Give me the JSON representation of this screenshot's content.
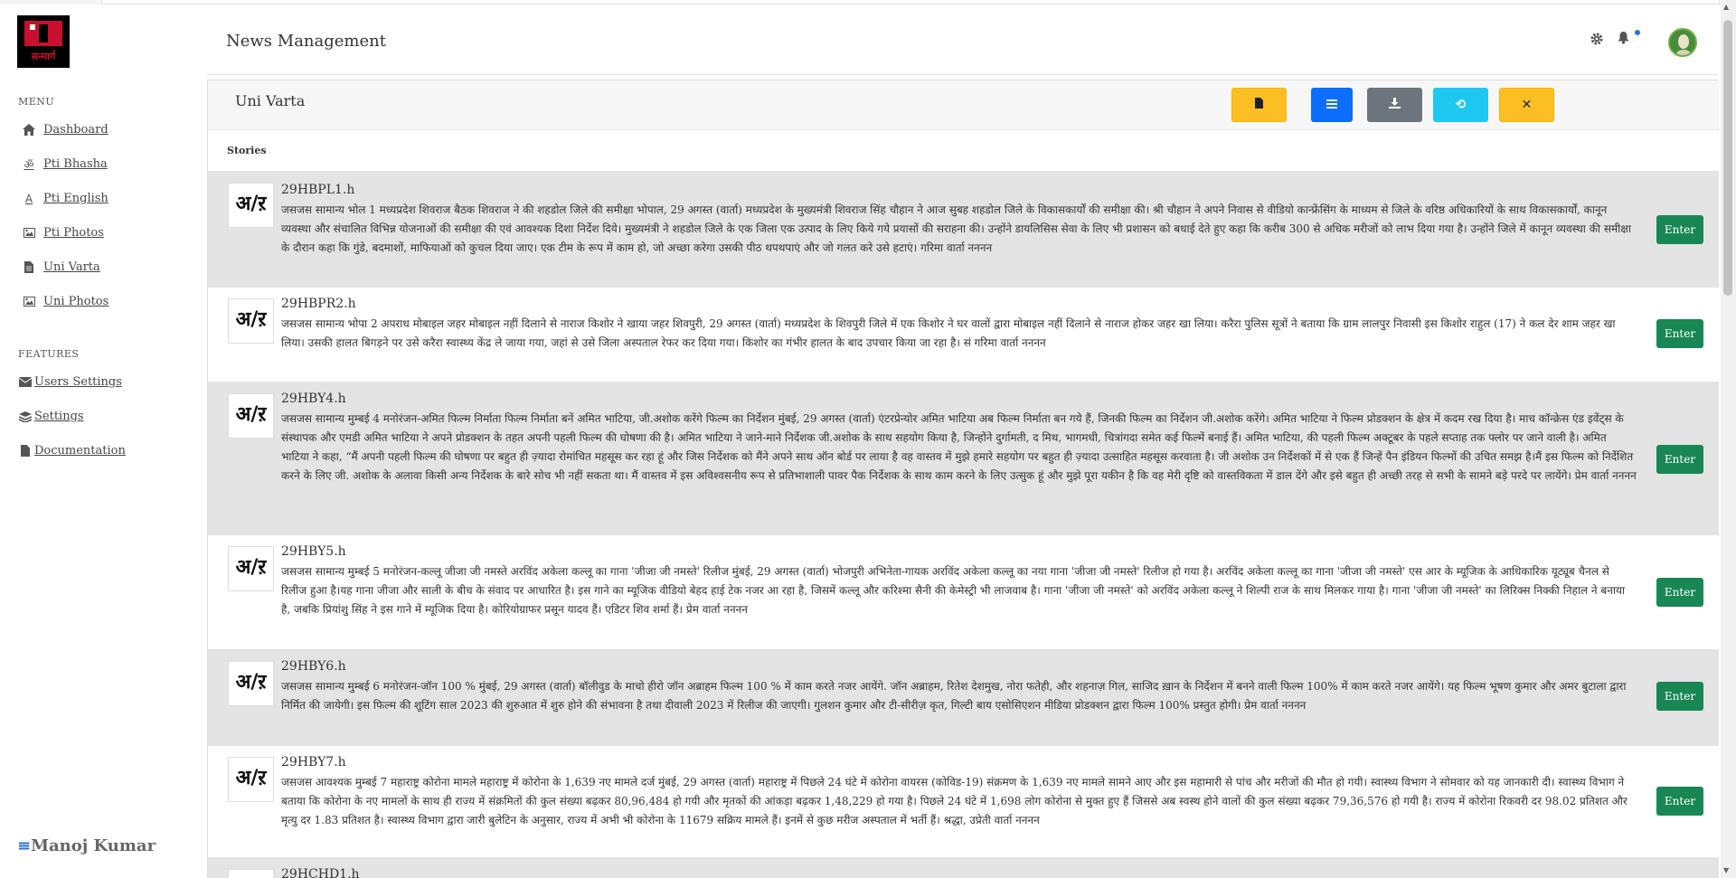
{
  "app": {
    "logo_text": "सन्मार्ग",
    "header_title": "News Management"
  },
  "sidebar": {
    "menu_heading": "MENU",
    "menu_items": [
      {
        "label": "Dashboard",
        "icon": "home-icon"
      },
      {
        "label": "Pti Bhasha",
        "icon": "om-icon"
      },
      {
        "label": "Pti English",
        "icon": "font-icon"
      },
      {
        "label": "Pti Photos",
        "icon": "image-icon"
      },
      {
        "label": "Uni Varta",
        "icon": "file-icon"
      },
      {
        "label": "Uni Photos",
        "icon": "image-icon"
      }
    ],
    "features_heading": "FEATURES",
    "feature_items": [
      {
        "label": "Users Settings",
        "icon": "envelope-icon"
      },
      {
        "label": "Settings",
        "icon": "layers-icon"
      },
      {
        "label": "Documentation",
        "icon": "document-icon"
      }
    ],
    "user_name": "Manoj Kumar"
  },
  "panel": {
    "title": "Uni Varta",
    "toolbar": [
      {
        "name": "new-file-button",
        "icon": "file-icon",
        "color": "#fbbf24"
      },
      {
        "name": "list-button",
        "icon": "list-icon",
        "color": "#0d6efd"
      },
      {
        "name": "download-button",
        "icon": "download-icon",
        "color": "#6c757d"
      },
      {
        "name": "refresh-button",
        "icon": "refresh-icon",
        "color": "#1ec8f0"
      },
      {
        "name": "close-button",
        "icon": "close-icon",
        "color": "#fbbf24"
      }
    ],
    "stories_label": "Stories",
    "enter_label": "Enter",
    "badge_glyph": "अ/ऱ"
  },
  "stories": [
    {
      "id": "29HBPL1.h",
      "text": "जसजस सामान्य भोल 1 मध्यप्रदेश शिवराज बैठक शिवराज ने की शहडोल जिले की समीक्षा भोपाल, 29 अगस्त (वार्ता) मध्यप्रदेश के मुख्यमंत्री शिवराज सिंह चौहान ने आज सुबह शहडोल जिले के विकासकार्यों की समीक्षा की। श्री चौहान ने अपने निवास से वीडियो कान्फ्रेंसिंग के माध्यम से जिले के वरिष्ठ अधिकारियों के साथ विकासकार्यों, कानून व्यवस्था और संचालित विभिन्न योजनाओं की समीक्षा की एवं आवश्यक दिशा निर्देश दिये। मुख्यमंत्री ने शहडोल जिले के एक जिला एक उत्पाद के लिए किये गये प्रयासों की सराहना की। उन्होंने डायलिसिस सेवा के लिए भी प्रशासन को बधाई देते हुए कहा कि करीब 300 से अधिक मरीजों को लाभ दिया गया है। उन्होंने जिले में कानून व्यवस्था की समीक्षा के दौरान कहा कि गुंडे, बदमाशों, माफियाओं को कुचल दिया जाए। एक टीम के रूप में काम हो, जो अच्छा करेगा उसकी पीठ थपथपाएं और जो गलत करे उसे हटाएं। गरिमा वार्ता नननन"
    },
    {
      "id": "29HBPR2.h",
      "text": "जसजस सामान्य भोपा 2 अपराध मोबाइल जहर मोबाइल नहीं दिलाने से नाराज किशोर ने खाया जहर शिवपुरी, 29 अगस्त (वार्ता) मध्यप्रदेश के शिवपुरी जिले में एक किशोर ने घर वालों द्वारा मोबाइल नहीं दिलाने से नाराज होकर जहर खा लिया। करैरा पुलिस सूत्रों ने बताया कि ग्राम लालपुर निवासी इस किशोर राहुल (17) ने कल देर शाम जहर खा लिया। उसकी हालत बिगड़ने पर उसे करैरा स्वास्थ्य केंद्र ले जाया गया, जहां से उसे जिला अस्पताल रेफर कर दिया गया। किशोर का गंभीर हालत के बाद उपचार किया जा रहा है। सं गरिमा वार्ता नननन"
    },
    {
      "id": "29HBY4.h",
      "text": "जसजस सामान्य मुम्बई 4 मनोरंजन-अमित फिल्म निर्माता फिल्म निर्माता बनें अमित भाटिया, जी.अशोक करेंगे फिल्म का निर्देशन मुंबई, 29 अगस्त (वार्ता) एंटरप्रेन्योर अमित भाटिया अब फिल्म निर्माता बन गये हैं, जिनकी फिल्म का निर्देशन जी.अशोक करेंगे। अमित भाटिया ने फिल्म प्रोडक्शन के क्षेत्र में कदम रख दिया है। माच कॉन्क्रेस एंड इवेंट्स के संस्थापक और एमडी अमित भाटिया ने अपने प्रोडक्शन के तहत अपनी पहली फिल्म की घोषणा की है। अमित भाटिया ने जाने-माने निर्देशक जी.अशोक के साथ सहयोग किया है, जिन्होंने दुर्गामती, द मिथ, भागमधी, चित्रांगदा समेत कई फिल्में बनाई हैं। अमित भाटिया, की पहली फिल्म अक्टूबर के पहले सप्ताह तक फ्लोर पर जाने वाली है। अमित भाटिया ने कहा, “मैं अपनी पहली फिल्म की घोषणा पर बहुत ही ज़्यादा रोमांचित महसूस कर रहा हूं और जिस निर्देशक को मैंने अपने साथ ऑन बोर्ड पर लाया है वह वास्तव में मुझे हमारे सहयोग पर बहुत ही ज़्यादा उत्साहित महसूस करवाता है। जी अशोक उन निर्देशकों में से एक हैं जिन्हें पैन इंडियन फिल्मों की उचित समझ है।मैं इस फिल्म को निर्देशित करने के लिए जी. अशोक के अलावा किसी अन्य निर्देशक के बारे सोच भी नहीं सकता था। मैं वास्तव में इस अविश्वसनीय रूप से प्रतिभाशाली पावर पैक निर्देशक के साथ काम करने के लिए उत्सुक हूं और मुझे पूरा यकीन है कि वह मेरी दृष्टि को वास्तविकता में डाल देंगे और इसे बहुत ही अच्छी तरह से सभी के सामने बड़े परदे पर लायेंगे। प्रेम वार्ता नननन"
    },
    {
      "id": "29HBY5.h",
      "text": "जसजस सामान्य मुम्बई 5 मनोरंजन-कल्लू जीजा जी नमस्ते अरविंद अकेला कल्लू का गाना 'जीजा जी नमस्ते' रिलीज मुंबई, 29 अगस्त (वार्ता) भोजपुरी अभिनेता-गायक अरविंद अकेला कल्लू का नया गाना 'जीजा जी नमस्ते' रिलीज हो गया है। अरविंद अकेला कल्लू का गाना 'जीजा जी नमस्ते' एस आर के म्यूजिक के आधिकारिक यूट्यूब चैनल से रिलीज हुआ है।यह गाना जीजा और साली के बीच के संवाद पर आधारित है। इस गाने का म्यूजिक वीडियो बेहद हाई टेक नजर आ रहा है, जिसमें कल्लू और करिश्मा सैनी की केमेस्ट्री भी लाजवाब है। गाना 'जीजा जी नमस्ते' को अरविंद अकेला कल्लू ने शिल्पी राज के साथ मिलकर गाया है। गाना 'जीजा जी नमस्ते' का लिरिक्स निक्की निहाल ने बनाया है, जबकि प्रियांशु सिंह ने इस गाने में म्यूजिक दिया है। कोरियोग्राफर प्रसून यादव हैं। एडिटर शिव शर्मा हैं। प्रेम वार्ता नननन"
    },
    {
      "id": "29HBY6.h",
      "text": "जसजस सामान्य मुम्बई 6 मनोरंजन-जॉन 100 % मुंबई, 29 अगस्त (वार्ता) बॉलीवुड के माचो हीरो जॉन अब्राहम फिल्म 100 % में काम करते नजर आयेंगे. जॉन अब्राहम, रितेश देशमुख, नोरा फतेही, और शहनाज़ गिल, साजिद ख़ान के निर्देशन में बनने वाली फिल्म 100% में काम करते नजर आयेंगे। यह फिल्म भूषण कुमार और अमर बुटाला द्वारा निर्मित की जायेगी। इस फिल्म की शूटिंग साल 2023 की शुरुआत में शुरु होने की संभावना है तथा दीवाली 2023 में रिलीज की जाएगी। गुलशन कुमार और टी-सीरीज़ कृत, गिल्टी बाय एसोसिएशन मीडिया प्रोडक्शन द्वारा फिल्म 100% प्रस्तुत होगी। प्रेम वार्ता नननन"
    },
    {
      "id": "29HBY7.h",
      "text": "जसजस आवश्यक मुम्बई 7 महाराष्ट्र कोरोना मामले महाराष्ट्र में कोरोना के 1,639 नए मामले दर्ज मुंबई, 29 अगस्त (वार्ता) महाराष्ट्र में पिछले 24 घंटे में कोरोना वायरस (कोविड-19) संक्रमण के 1,639 नए मामले सामने आए और इस महामारी से पांच और मरीजों की मौत हो गयी। स्वास्थ्य विभाग ने सोमवार को यह जानकारी दी। स्वास्थ्य विभाग ने बताया कि कोरोना के नए मामलों के साथ ही राज्य में संक्रमितों की कुल संख्या बढ़कर 80,96,484 हो गयी और मृतकों की आंकड़ा बढ़कर 1,48,229 हो गया है। पिछले 24 घंटे में 1,698 लोग कोरोना से मुक्त हुए हैं जिससे अब स्वस्थ होने वालों की कुल संख्या बढ़कर 79,36,576 हो गयी है। राज्य में कोरोना रिकवरी दर 98.02 प्रतिशत और मृत्यु दर 1.83 प्रतिशत है। स्वास्थ्य विभाग द्वारा जारी बुलेटिन के अनुसार, राज्य में अभी भी कोरोना के 11679 सक्रिय मामले हैं। इनमें से कुछ मरीज अस्पताल में भर्ती हैं। श्रद्धा, उप्रेती वार्ता नननन"
    },
    {
      "id": "29HCHD1.h",
      "text": ""
    }
  ]
}
